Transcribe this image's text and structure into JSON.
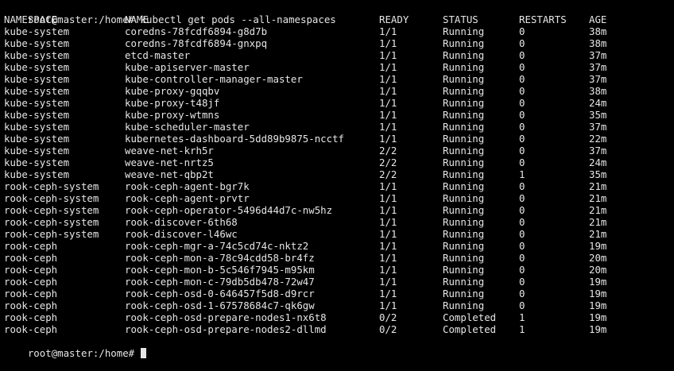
{
  "terminal": {
    "prompt": "root@master:/home# ",
    "command": "kubectl get pods --all-namespaces",
    "last_prompt": "root@master:/home# ",
    "text_color": "#e6e6e6",
    "background_color": "#000000"
  },
  "table": {
    "headers": {
      "namespace": "NAMESPACE",
      "name": "NAME",
      "ready": "READY",
      "status": "STATUS",
      "restarts": "RESTARTS",
      "age": "AGE"
    },
    "rows": [
      {
        "namespace": "kube-system",
        "name": "coredns-78fcdf6894-g8d7b",
        "ready": "1/1",
        "status": "Running",
        "restarts": "0",
        "age": "38m"
      },
      {
        "namespace": "kube-system",
        "name": "coredns-78fcdf6894-gnxpq",
        "ready": "1/1",
        "status": "Running",
        "restarts": "0",
        "age": "38m"
      },
      {
        "namespace": "kube-system",
        "name": "etcd-master",
        "ready": "1/1",
        "status": "Running",
        "restarts": "0",
        "age": "37m"
      },
      {
        "namespace": "kube-system",
        "name": "kube-apiserver-master",
        "ready": "1/1",
        "status": "Running",
        "restarts": "0",
        "age": "37m"
      },
      {
        "namespace": "kube-system",
        "name": "kube-controller-manager-master",
        "ready": "1/1",
        "status": "Running",
        "restarts": "0",
        "age": "37m"
      },
      {
        "namespace": "kube-system",
        "name": "kube-proxy-gqqbv",
        "ready": "1/1",
        "status": "Running",
        "restarts": "0",
        "age": "38m"
      },
      {
        "namespace": "kube-system",
        "name": "kube-proxy-t48jf",
        "ready": "1/1",
        "status": "Running",
        "restarts": "0",
        "age": "24m"
      },
      {
        "namespace": "kube-system",
        "name": "kube-proxy-wtmns",
        "ready": "1/1",
        "status": "Running",
        "restarts": "0",
        "age": "35m"
      },
      {
        "namespace": "kube-system",
        "name": "kube-scheduler-master",
        "ready": "1/1",
        "status": "Running",
        "restarts": "0",
        "age": "37m"
      },
      {
        "namespace": "kube-system",
        "name": "kubernetes-dashboard-5dd89b9875-ncctf",
        "ready": "1/1",
        "status": "Running",
        "restarts": "0",
        "age": "22m"
      },
      {
        "namespace": "kube-system",
        "name": "weave-net-krh5r",
        "ready": "2/2",
        "status": "Running",
        "restarts": "0",
        "age": "37m"
      },
      {
        "namespace": "kube-system",
        "name": "weave-net-nrtz5",
        "ready": "2/2",
        "status": "Running",
        "restarts": "0",
        "age": "24m"
      },
      {
        "namespace": "kube-system",
        "name": "weave-net-qbp2t",
        "ready": "2/2",
        "status": "Running",
        "restarts": "1",
        "age": "35m"
      },
      {
        "namespace": "rook-ceph-system",
        "name": "rook-ceph-agent-bgr7k",
        "ready": "1/1",
        "status": "Running",
        "restarts": "0",
        "age": "21m"
      },
      {
        "namespace": "rook-ceph-system",
        "name": "rook-ceph-agent-prvtr",
        "ready": "1/1",
        "status": "Running",
        "restarts": "0",
        "age": "21m"
      },
      {
        "namespace": "rook-ceph-system",
        "name": "rook-ceph-operator-5496d44d7c-nw5hz",
        "ready": "1/1",
        "status": "Running",
        "restarts": "0",
        "age": "21m"
      },
      {
        "namespace": "rook-ceph-system",
        "name": "rook-discover-6th68",
        "ready": "1/1",
        "status": "Running",
        "restarts": "0",
        "age": "21m"
      },
      {
        "namespace": "rook-ceph-system",
        "name": "rook-discover-l46wc",
        "ready": "1/1",
        "status": "Running",
        "restarts": "0",
        "age": "21m"
      },
      {
        "namespace": "rook-ceph",
        "name": "rook-ceph-mgr-a-74c5cd74c-nktz2",
        "ready": "1/1",
        "status": "Running",
        "restarts": "0",
        "age": "19m"
      },
      {
        "namespace": "rook-ceph",
        "name": "rook-ceph-mon-a-78c94cdd58-br4fz",
        "ready": "1/1",
        "status": "Running",
        "restarts": "0",
        "age": "20m"
      },
      {
        "namespace": "rook-ceph",
        "name": "rook-ceph-mon-b-5c546f7945-m95km",
        "ready": "1/1",
        "status": "Running",
        "restarts": "0",
        "age": "20m"
      },
      {
        "namespace": "rook-ceph",
        "name": "rook-ceph-mon-c-79db5db478-72w47",
        "ready": "1/1",
        "status": "Running",
        "restarts": "0",
        "age": "19m"
      },
      {
        "namespace": "rook-ceph",
        "name": "rook-ceph-osd-0-646457f5d8-d9rcr",
        "ready": "1/1",
        "status": "Running",
        "restarts": "0",
        "age": "19m"
      },
      {
        "namespace": "rook-ceph",
        "name": "rook-ceph-osd-1-67578684c7-qk6gw",
        "ready": "1/1",
        "status": "Running",
        "restarts": "0",
        "age": "19m"
      },
      {
        "namespace": "rook-ceph",
        "name": "rook-ceph-osd-prepare-nodes1-nx6t8",
        "ready": "0/2",
        "status": "Completed",
        "restarts": "1",
        "age": "19m"
      },
      {
        "namespace": "rook-ceph",
        "name": "rook-ceph-osd-prepare-nodes2-dllmd",
        "ready": "0/2",
        "status": "Completed",
        "restarts": "1",
        "age": "19m"
      }
    ]
  }
}
